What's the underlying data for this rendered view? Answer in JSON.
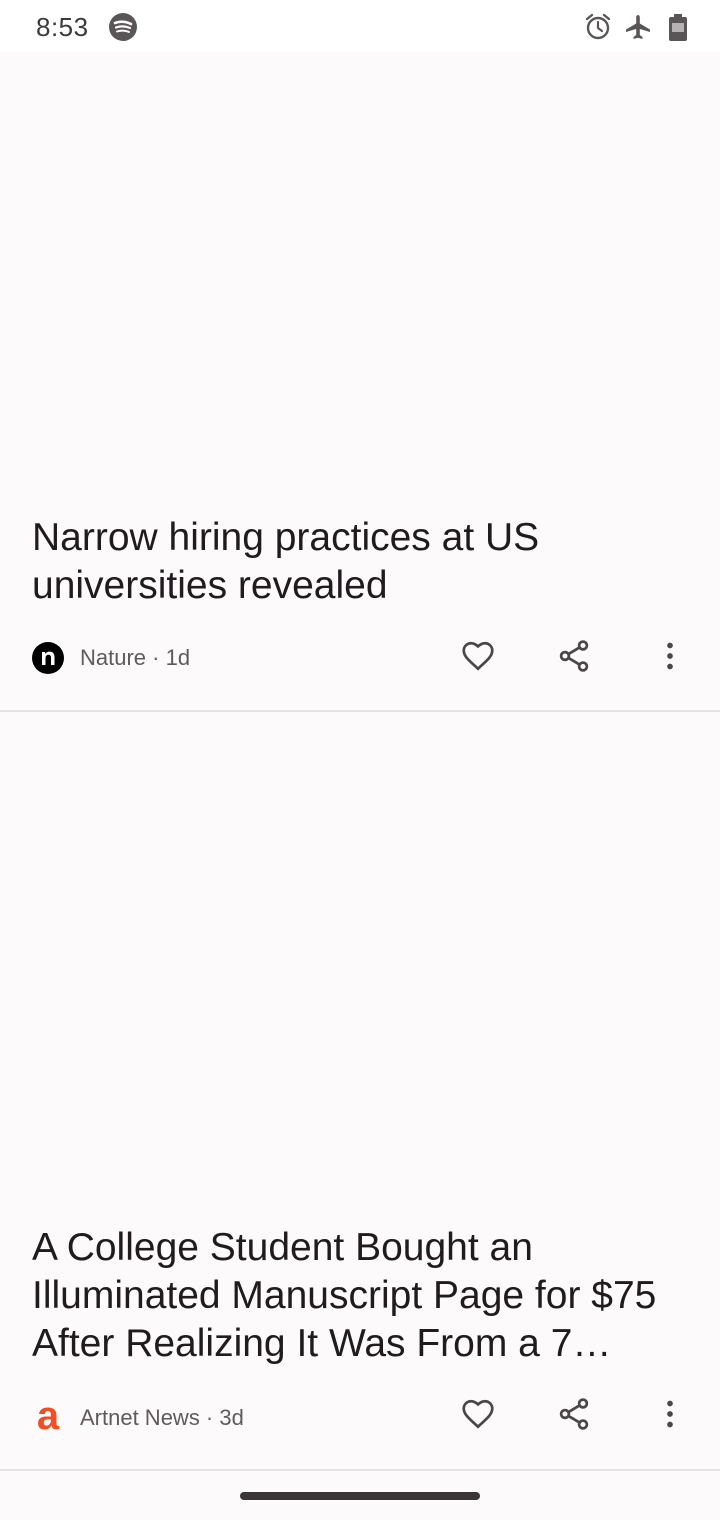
{
  "status_bar": {
    "time": "8:53",
    "left_icons": [
      "spotify-icon"
    ],
    "right_icons": [
      "alarm-icon",
      "airplane-mode-icon",
      "battery-icon"
    ]
  },
  "articles": [
    {
      "title": "Narrow hiring practices at US universities revealed",
      "source": "Nature",
      "age": "1d",
      "source_line": "Nature · 1d",
      "logo": "nature-logo",
      "actions": [
        "favorite-icon",
        "share-icon",
        "more-vert-icon"
      ]
    },
    {
      "title": "A College Student Bought an Illuminated Manuscript Page for $75 After Realizing It Was From a 7…",
      "source": "Artnet News",
      "age": "3d",
      "source_line": "Artnet News · 3d",
      "logo": "artnet-logo",
      "actions": [
        "favorite-icon",
        "share-icon",
        "more-vert-icon"
      ]
    }
  ],
  "colors": {
    "background": "#fdfafb",
    "text_primary": "#1f1b1e",
    "text_secondary": "#5e5a5d",
    "icon": "#4a4649",
    "artnet_accent": "#f04e23",
    "divider": "#e6e2e4"
  }
}
